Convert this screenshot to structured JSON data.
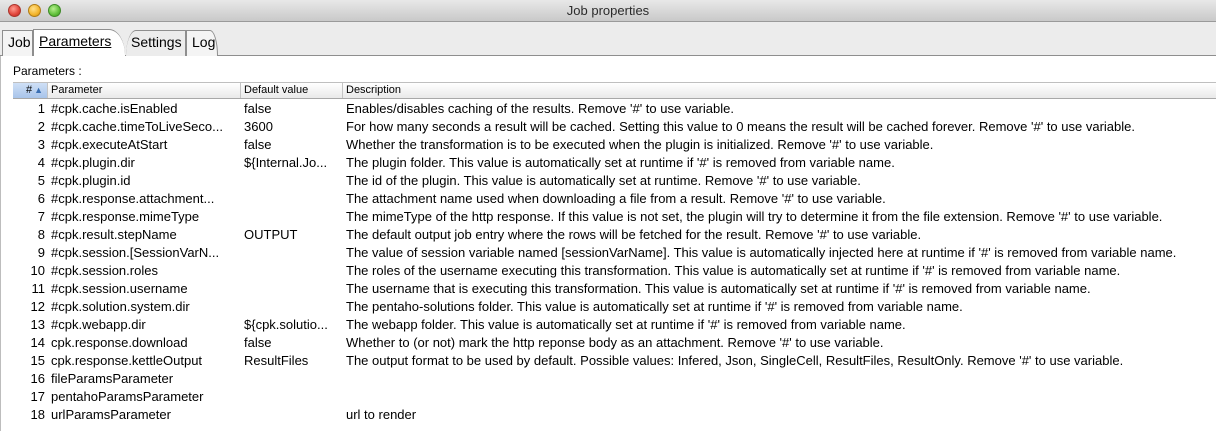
{
  "window": {
    "title": "Job properties"
  },
  "tabs": [
    {
      "label": "Job"
    },
    {
      "label": "Parameters"
    },
    {
      "label": "Settings"
    },
    {
      "label": "Log"
    }
  ],
  "panel": {
    "section_label": "Parameters :"
  },
  "table": {
    "headers": {
      "num": "#",
      "parameter": "Parameter",
      "default": "Default value",
      "description": "Description"
    },
    "sort_glyph": "▲",
    "rows": [
      {
        "num": "1",
        "parameter": "#cpk.cache.isEnabled",
        "default": "false",
        "description": "Enables/disables caching of the results. Remove '#' to use variable."
      },
      {
        "num": "2",
        "parameter": "#cpk.cache.timeToLiveSeco...",
        "default": "3600",
        "description": "For how many seconds a result will be cached. Setting this value to 0 means the result will be cached forever. Remove '#' to use variable."
      },
      {
        "num": "3",
        "parameter": "#cpk.executeAtStart",
        "default": "false",
        "description": "Whether the transformation is to be executed when the plugin is initialized. Remove '#' to use variable."
      },
      {
        "num": "4",
        "parameter": "#cpk.plugin.dir",
        "default": "${Internal.Jo...",
        "description": "The plugin folder. This value is automatically set at runtime if '#' is removed from variable name."
      },
      {
        "num": "5",
        "parameter": "#cpk.plugin.id",
        "default": "",
        "description": "The id of the plugin. This value is automatically set at runtime. Remove '#' to use variable."
      },
      {
        "num": "6",
        "parameter": "#cpk.response.attachment...",
        "default": "",
        "description": "The attachment name used when downloading a file from a result. Remove '#' to use variable."
      },
      {
        "num": "7",
        "parameter": "#cpk.response.mimeType",
        "default": "",
        "description": "The mimeType of the http response. If this value is not set, the plugin will try to determine it from the file extension. Remove '#' to use variable."
      },
      {
        "num": "8",
        "parameter": "#cpk.result.stepName",
        "default": "OUTPUT",
        "description": "The default output job entry where the rows will be fetched for the result. Remove '#' to use variable."
      },
      {
        "num": "9",
        "parameter": "#cpk.session.[SessionVarN...",
        "default": "",
        "description": "The value of session variable named [sessionVarName]. This value is automatically injected here at runtime if '#' is removed from variable name."
      },
      {
        "num": "10",
        "parameter": "#cpk.session.roles",
        "default": "",
        "description": "The roles of the username executing this transformation. This value is automatically set at runtime if '#' is removed from variable name."
      },
      {
        "num": "11",
        "parameter": "#cpk.session.username",
        "default": "",
        "description": "The username that is executing this transformation. This value is automatically set at runtime if '#' is removed from variable name."
      },
      {
        "num": "12",
        "parameter": "#cpk.solution.system.dir",
        "default": "",
        "description": "The pentaho-solutions folder. This value is automatically set at runtime if '#' is removed from variable name."
      },
      {
        "num": "13",
        "parameter": "#cpk.webapp.dir",
        "default": "${cpk.solutio...",
        "description": "The webapp folder. This value is automatically set at runtime if '#' is removed from variable name."
      },
      {
        "num": "14",
        "parameter": "cpk.response.download",
        "default": "false",
        "description": "Whether to (or not) mark the http reponse body as an attachment. Remove '#' to use variable."
      },
      {
        "num": "15",
        "parameter": "cpk.response.kettleOutput",
        "default": "ResultFiles",
        "description": "The output format to be used by default. Possible values: Infered, Json, SingleCell, ResultFiles, ResultOnly. Remove '#' to use variable."
      },
      {
        "num": "16",
        "parameter": "fileParamsParameter",
        "default": "",
        "description": ""
      },
      {
        "num": "17",
        "parameter": "pentahoParamsParameter",
        "default": "",
        "description": ""
      },
      {
        "num": "18",
        "parameter": "urlParamsParameter",
        "default": "",
        "description": "url to render"
      }
    ]
  }
}
